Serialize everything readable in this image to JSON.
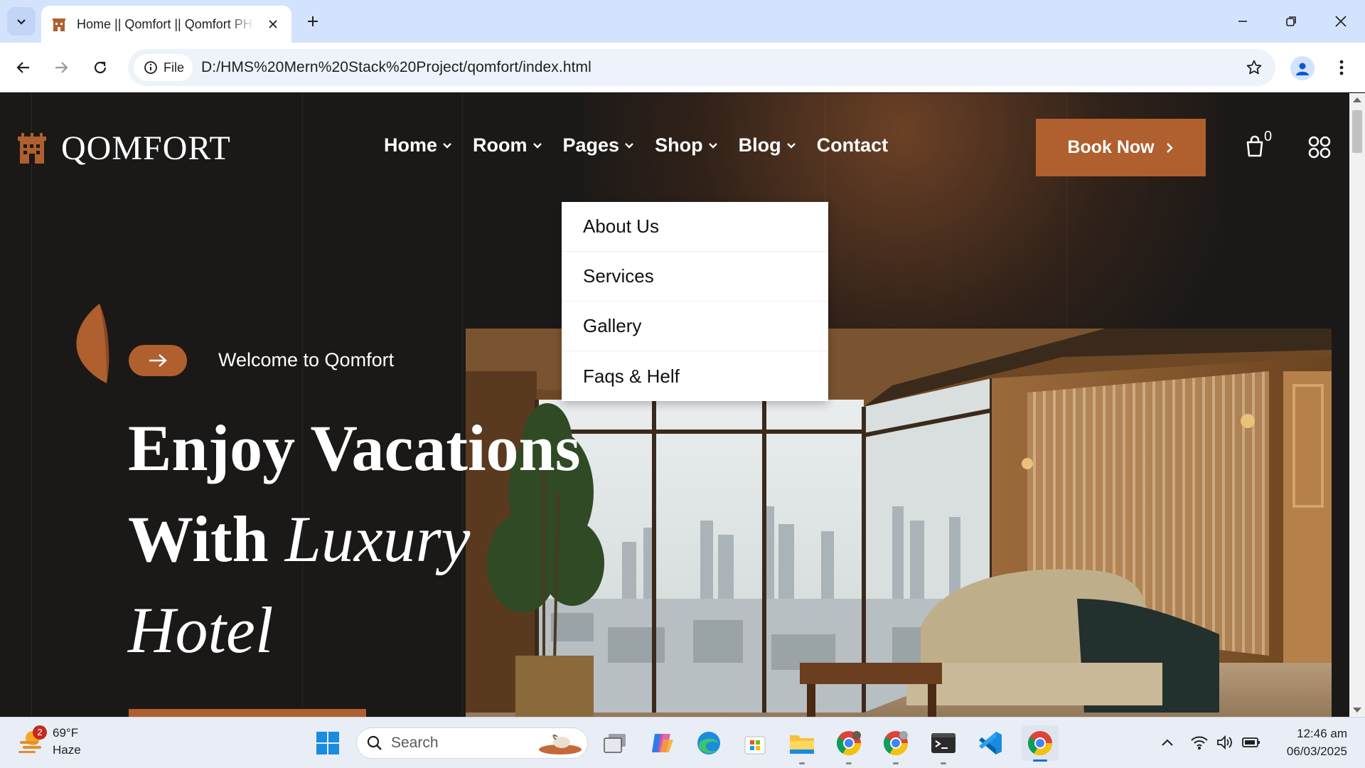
{
  "browser": {
    "tab_title": "Home || Qomfort || Qomfort PHP",
    "site_chip": "File",
    "url": "D:/HMS%20Mern%20Stack%20Project/qomfort/index.html"
  },
  "header": {
    "logo_text": "QOMFORT",
    "nav": [
      {
        "label": "Home",
        "has_dropdown": true
      },
      {
        "label": "Room",
        "has_dropdown": true
      },
      {
        "label": "Pages",
        "has_dropdown": true
      },
      {
        "label": "Shop",
        "has_dropdown": true
      },
      {
        "label": "Blog",
        "has_dropdown": true
      },
      {
        "label": "Contact",
        "has_dropdown": false
      }
    ],
    "book_button": "Book Now",
    "cart_count": "0"
  },
  "dropdown": {
    "items": [
      "About Us",
      "Services",
      "Gallery",
      "Faqs & Helf"
    ]
  },
  "hero": {
    "welcome": "Welcome to Qomfort",
    "title_line1": "Enjoy Vacations",
    "title_line2_plain": "With",
    "title_line2_italic": "Luxury",
    "title_line3_italic": "Hotel"
  },
  "taskbar": {
    "weather_temp": "69°F",
    "weather_desc": "Haze",
    "weather_badge": "2",
    "search_placeholder": "Search",
    "time": "12:46 am",
    "date": "06/03/2025"
  },
  "colors": {
    "accent": "#b05f2e",
    "page_bg": "#1b1918",
    "tabbar_bg": "#d3e3fd"
  },
  "icons": [
    "tab-list-icon",
    "hotel-icon",
    "close-icon",
    "plus-icon",
    "minimize-icon",
    "restore-icon",
    "back-icon",
    "forward-icon",
    "reload-icon",
    "info-icon",
    "star-icon",
    "profile-icon",
    "kebab-menu-icon",
    "chevron-down-icon",
    "chevron-right-icon",
    "cart-icon",
    "grid-icon",
    "arrow-right-icon",
    "windows-start-icon",
    "search-icon",
    "copilot-icon",
    "edge-icon",
    "store-icon",
    "file-explorer-icon",
    "chrome-icon",
    "terminal-icon",
    "vscode-icon",
    "wifi-icon",
    "volume-icon",
    "battery-icon",
    "chevron-up-icon"
  ]
}
